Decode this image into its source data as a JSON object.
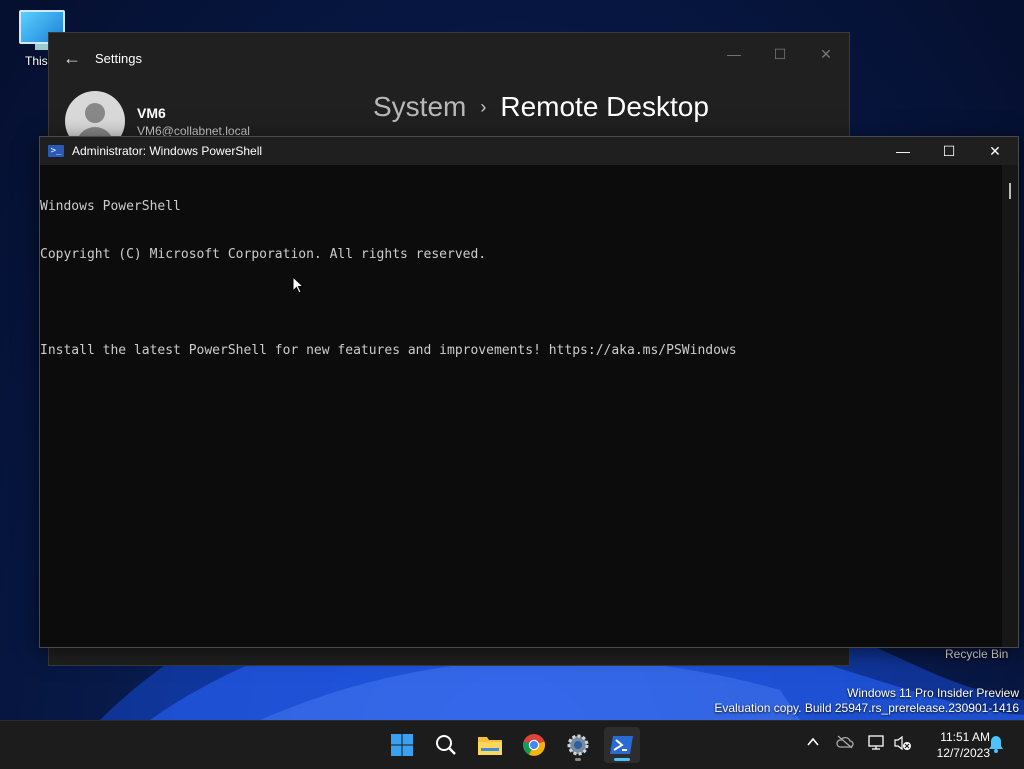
{
  "desktop": {
    "this_pc_label": "This P",
    "recycle_bin_label": "Recycle Bin",
    "watermark_line1": "Windows 11 Pro Insider Preview",
    "watermark_line2": "Evaluation copy. Build 25947.rs_prerelease.230901-1416"
  },
  "settings": {
    "title": "Settings",
    "user_name": "VM6",
    "user_email": "VM6@collabnet.local",
    "crumb_parent": "System",
    "crumb_current": "Remote Desktop"
  },
  "powershell": {
    "title": "Administrator: Windows PowerShell",
    "lines": [
      "Windows PowerShell",
      "Copyright (C) Microsoft Corporation. All rights reserved.",
      "",
      "Install the latest PowerShell for new features and improvements! https://aka.ms/PSWindows"
    ]
  },
  "taskbar": {
    "time": "11:51 AM",
    "date": "12/7/2023",
    "apps": [
      "start-icon",
      "search-icon",
      "file-explorer-icon",
      "chrome-icon",
      "settings-icon",
      "powershell-icon"
    ]
  },
  "colors": {
    "accent": "#0078d4",
    "console_bg": "#0c0c0c",
    "console_text": "#cccccc"
  }
}
